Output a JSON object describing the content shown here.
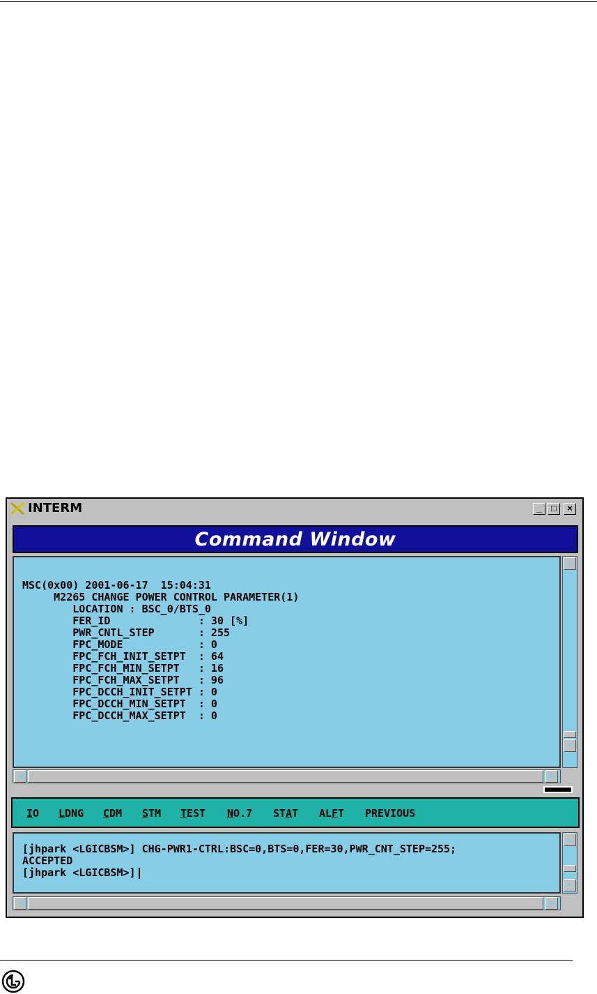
{
  "window": {
    "title": "INTERM",
    "controls": {
      "minimize": "_",
      "maximize": "□",
      "close": "×"
    }
  },
  "header": {
    "title": "Command Window"
  },
  "output": {
    "lines": [
      "MSC(0x00) 2001-06-17  15:04:31",
      "     M2265 CHANGE POWER CONTROL PARAMETER(1)",
      "        LOCATION : BSC_0/BTS_0",
      "        FER_ID              : 30 [%]",
      "        PWR_CNTL_STEP       : 255",
      "        FPC_MODE            : 0",
      "        FPC_FCH_INIT_SETPT  : 64",
      "        FPC_FCH_MIN_SETPT   : 16",
      "        FPC_FCH_MAX_SETPT   : 96",
      "        FPC_DCCH_INIT_SETPT : 0",
      "        FPC_DCCH_MIN_SETPT  : 0",
      "        FPC_DCCH_MAX_SETPT  : 0"
    ]
  },
  "menu": {
    "items": [
      {
        "pre": "",
        "u": "I",
        "post": "O"
      },
      {
        "pre": "",
        "u": "L",
        "post": "DNG"
      },
      {
        "pre": "",
        "u": "C",
        "post": "DM"
      },
      {
        "pre": "",
        "u": "S",
        "post": "TM"
      },
      {
        "pre": "",
        "u": "T",
        "post": "EST"
      },
      {
        "pre": "",
        "u": "N",
        "post": "O.7"
      },
      {
        "pre": "ST",
        "u": "A",
        "post": "T"
      },
      {
        "pre": "AL",
        "u": "F",
        "post": "T"
      },
      {
        "pre": "PREVIOUS",
        "u": "",
        "post": ""
      }
    ]
  },
  "input": {
    "lines": [
      "[jhpark <LGICBSM>] CHG-PWR1-CTRL:BSC=0,BTS=0,FER=30,PWR_CNT_STEP=255;",
      "ACCEPTED"
    ],
    "prompt": "[jhpark <LGICBSM>]"
  },
  "icons": {
    "title_icon": "x-logo-icon",
    "footer_logo": "lg-logo-icon"
  },
  "colors": {
    "pane_bg": "#87cde6",
    "header_bg": "#10109a",
    "menu_bg": "#1fb2a6",
    "chrome": "#c0c0c0"
  }
}
